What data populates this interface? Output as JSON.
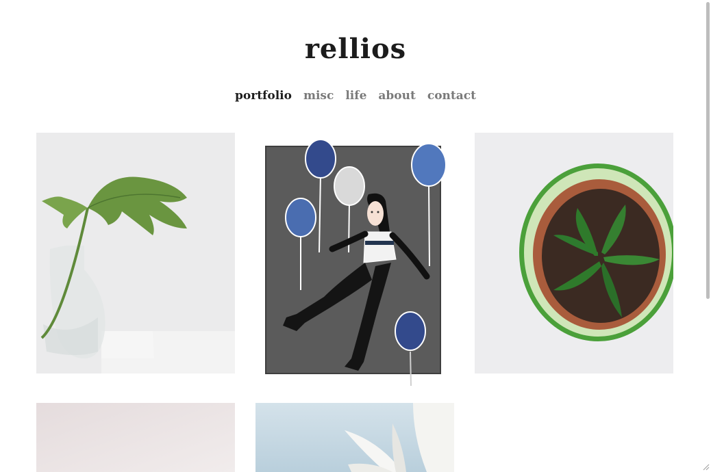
{
  "site": {
    "title": "rellios"
  },
  "nav": {
    "items": [
      {
        "label": "portfolio",
        "active": true
      },
      {
        "label": "misc",
        "active": false
      },
      {
        "label": "life",
        "active": false
      },
      {
        "label": "about",
        "active": false
      },
      {
        "label": "contact",
        "active": false
      }
    ]
  },
  "gallery": {
    "items": [
      {
        "subject": "monstera leaf in glass vase"
      },
      {
        "subject": "illustration of girl with balloons"
      },
      {
        "subject": "potted pepper seedling"
      },
      {
        "subject": "pale pink background"
      },
      {
        "subject": "white flower petals against sky"
      }
    ]
  },
  "colors": {
    "accent_active": "#1e1e1e",
    "nav_inactive": "#7a7a7a",
    "balloon_blue": "#3f5aa0"
  }
}
